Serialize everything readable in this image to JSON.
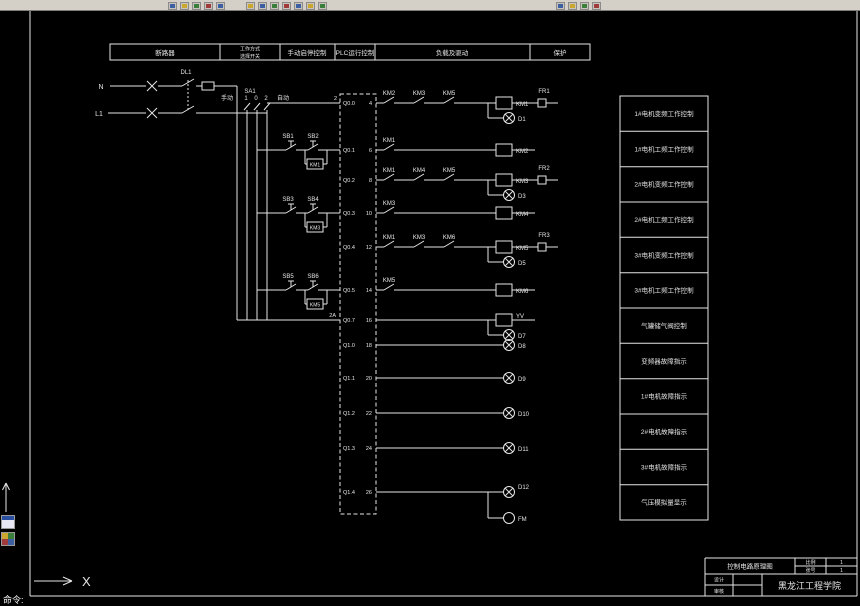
{
  "window": {
    "toolbar_icons": [
      "toolbar-icon-1",
      "toolbar-icon-2",
      "toolbar-icon-3",
      "toolbar-icon-4",
      "toolbar-icon-5",
      "toolbar-icon-6",
      "toolbar-icon-7",
      "toolbar-icon-8",
      "toolbar-icon-9",
      "toolbar-icon-10",
      "toolbar-icon-11",
      "toolbar-icon-12",
      "toolbar-icon-13",
      "toolbar-icon-14",
      "toolbar-icon-15",
      "toolbar-icon-16"
    ],
    "command_line": "命令:"
  },
  "header": {
    "breaker": "断路器",
    "mode_line1": "工作方式",
    "mode_line2": "选择开关",
    "manual": "手动启停控制",
    "plc": "PLC运行控制",
    "load": "负载及驱动",
    "protect": "保护"
  },
  "power": {
    "n": "N",
    "l1": "L1",
    "breaker": "DL1",
    "selector": "SA1",
    "manual": "手动",
    "pos1": "1",
    "pos0": "0",
    "pos2": "2",
    "auto": "自动",
    "left_term": "2",
    "common": "2A"
  },
  "buttons": {
    "groups": [
      {
        "stop": "SB1",
        "start": "SB2",
        "hold": "KM1"
      },
      {
        "stop": "SB3",
        "start": "SB4",
        "hold": "KM3"
      },
      {
        "stop": "SB5",
        "start": "SB6",
        "hold": "KM5"
      }
    ]
  },
  "plc": {
    "rows": [
      {
        "label": "Q0.0",
        "term": "4"
      },
      {
        "label": "Q0.1",
        "term": "6"
      },
      {
        "label": "Q0.2",
        "term": "8"
      },
      {
        "label": "Q0.3",
        "term": "10"
      },
      {
        "label": "Q0.4",
        "term": "12"
      },
      {
        "label": "Q0.5",
        "term": "14"
      },
      {
        "label": "Q0.7",
        "term": "16"
      },
      {
        "label": "Q1.0",
        "term": "18"
      },
      {
        "label": "Q1.1",
        "term": "20"
      },
      {
        "label": "Q1.2",
        "term": "22"
      },
      {
        "label": "Q1.3",
        "term": "24"
      },
      {
        "label": "Q1.4",
        "term": "26"
      }
    ]
  },
  "loads": {
    "rows": [
      {
        "contacts": [
          "KM2",
          "KM3",
          "KM5"
        ],
        "coil": "KM1",
        "relay": "FR1",
        "lamp": "D1"
      },
      {
        "contacts": [
          "KM1"
        ],
        "coil": "KM2"
      },
      {
        "contacts": [
          "KM1",
          "KM4",
          "KM5"
        ],
        "coil": "KM3",
        "relay": "FR2",
        "lamp": "D3"
      },
      {
        "contacts": [
          "KM3"
        ],
        "coil": "KM4"
      },
      {
        "contacts": [
          "KM1",
          "KM3",
          "KM6"
        ],
        "coil": "KM5",
        "relay": "FR3",
        "lamp": "D5"
      },
      {
        "contacts": [
          "KM5"
        ],
        "coil": "KM6"
      },
      {
        "coil": "YV",
        "lamp": "D7"
      },
      {
        "lamp": "D8"
      },
      {
        "lamp": "D9"
      },
      {
        "lamp": "D10"
      },
      {
        "lamp": "D11"
      },
      {
        "lamp": "D12",
        "alarm": "FM"
      }
    ]
  },
  "functions": [
    "1#电机变频工作控制",
    "1#电机工频工作控制",
    "2#电机变频工作控制",
    "2#电机工频工作控制",
    "3#电机变频工作控制",
    "3#电机工频工作控制",
    "气罐储气阀控制",
    "变频器故障指示",
    "1#电机故障指示",
    "2#电机故障指示",
    "3#电机故障指示",
    "气压模拟量显示"
  ],
  "titleblock": {
    "title": "控制电路原理图",
    "scale_label": "比例",
    "scale_value": "1",
    "sheet_label": "张号",
    "sheet_value": "1",
    "design_label": "设计",
    "audit_label": "审核",
    "school": "黑龙江工程学院"
  },
  "ucs": {
    "x": "X"
  }
}
